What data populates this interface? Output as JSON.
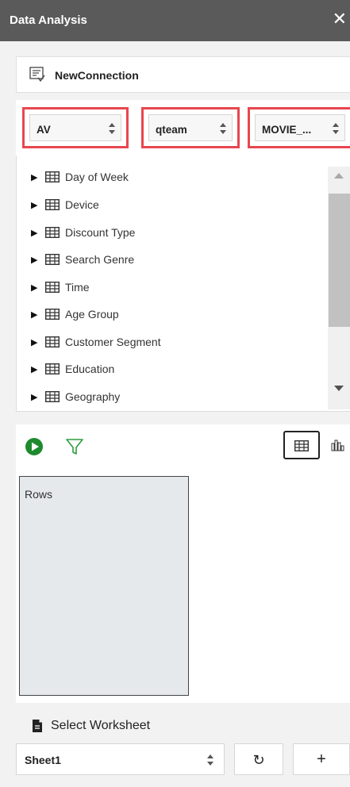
{
  "window": {
    "title": "Data Analysis",
    "close_icon": "close-icon"
  },
  "connection": {
    "label": "NewConnection",
    "icon": "connection-icon"
  },
  "selectors": [
    {
      "value": "AV"
    },
    {
      "value": "qteam"
    },
    {
      "value": "MOVIE_..."
    }
  ],
  "tree": {
    "items": [
      {
        "label": "Day of Week"
      },
      {
        "label": "Device"
      },
      {
        "label": "Discount Type"
      },
      {
        "label": "Search Genre"
      },
      {
        "label": "Time"
      },
      {
        "label": "Age Group"
      },
      {
        "label": "Customer Segment"
      },
      {
        "label": "Education"
      },
      {
        "label": "Geography"
      }
    ]
  },
  "toolbar": {
    "run_icon": "play-icon",
    "filter_icon": "filter-icon",
    "table_view_icon": "table-icon",
    "chart_view_icon": "bar-chart-icon"
  },
  "rows": {
    "label": "Rows"
  },
  "worksheet": {
    "title": "Select Worksheet",
    "selected": "Sheet1",
    "refresh_glyph": "↻",
    "add_glyph": "+"
  },
  "colors": {
    "titlebar": "#5a5a5a",
    "highlight": "#e8474f",
    "run": "#1e8a2e",
    "filter": "#2e9d3e",
    "rows_bg": "#e6e9ec"
  }
}
